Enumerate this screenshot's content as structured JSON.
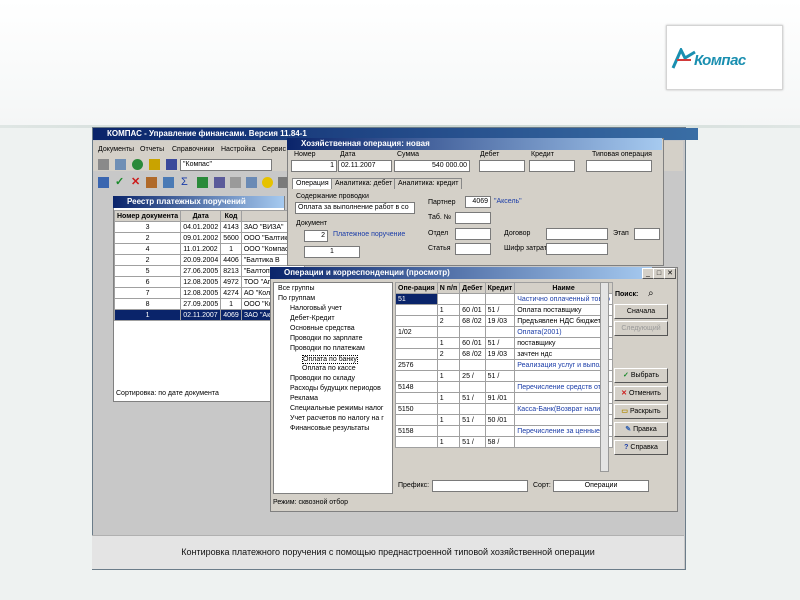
{
  "logo": {
    "text": "Компас"
  },
  "caption": "Контировка платежного поручения с помощью преднастроенной типовой хозяйственной операции",
  "app": {
    "title": "КОМПАС - Управление финансами. Версия 11.84-1",
    "menu": [
      "Документы",
      "Отчеты",
      "Справочники",
      "Настройка",
      "Сервис"
    ],
    "org_field": "\"Компас\""
  },
  "registry": {
    "title": "Реестр платежных поручений",
    "headers": [
      "Номер документа",
      "Дата",
      "Код",
      ""
    ],
    "rows": [
      [
        "3",
        "04.01.2002",
        "4143",
        "ЗАО \"ВИЗА\""
      ],
      [
        "2",
        "09.01.2002",
        "5600",
        "ООО \"Балтика Ро"
      ],
      [
        "4",
        "11.01.2002",
        "1",
        "ООО \"Компас\""
      ],
      [
        "2",
        "20.09.2004",
        "4406",
        "\"Балтика В"
      ],
      [
        "5",
        "27.06.2005",
        "8213",
        "\"Балтоптто"
      ],
      [
        "6",
        "12.08.2005",
        "4972",
        "ТОО \"Апре"
      ],
      [
        "7",
        "12.08.2005",
        "4274",
        "АО \"Колобс"
      ],
      [
        "8",
        "27.09.2005",
        "1",
        "ООО \"Конт"
      ],
      [
        "1",
        "02.11.2007",
        "4069",
        "ЗАО \"Аксел"
      ]
    ],
    "status": "Сортировка: по дате документа"
  },
  "hoz": {
    "title": "Хозяйственная операция: новая",
    "labels": {
      "nomer": "Номер",
      "data": "Дата",
      "summa": "Сумма",
      "debet": "Дебет",
      "kredit": "Кредит",
      "tip": "Типовая операция",
      "soderzhanie": "Содержание проводки",
      "partner": "Партнер",
      "tab": "Таб. №",
      "otdel": "Отдел",
      "dogovor": "Договор",
      "etap": "Этап",
      "statya": "Статья",
      "shifr": "Шифр затрат",
      "dokument": "Документ"
    },
    "values": {
      "nomer": "1",
      "data": "02.11.2007",
      "summa": "540 000.00",
      "soderzhanie": "Оплата за выполнение работ в со",
      "partner_code": "4069",
      "partner_name": "\"Аксель\"",
      "doc_num": "2",
      "doc_type": "Платежное поручение",
      "doc_n2": "1"
    },
    "tabs": [
      "Операция",
      "Аналитика: дебет",
      "Аналитика: кредит"
    ]
  },
  "ops": {
    "title": "Операции и корреспонденции (просмотр)",
    "tree": [
      "Все группы",
      "По группам",
      "Налоговый учет",
      "Дебет-Кредит",
      "Основные средства",
      "Проводки по зарплате",
      "Проводки по платежам",
      "Оплата по банку",
      "Оплата по кассе",
      "Проводки по складу",
      "Расходы будущих периодов",
      "Реклама",
      "Специальные режимы налог",
      "Учет расчетов по налогу на г",
      "Финансовые результаты"
    ],
    "headers": [
      "Опе-рация",
      "N п/п",
      "Дебет",
      "Кредит",
      "Наиме"
    ],
    "rows": [
      [
        "51",
        "",
        "",
        "",
        "Частично оплаченный товар"
      ],
      [
        "",
        "1",
        "60 /01",
        "51 /",
        "Оплата поставщику"
      ],
      [
        "",
        "2",
        "68 /02",
        "19 /03",
        "Предъявлен НДС бюджету"
      ],
      [
        "1/02",
        "",
        "",
        "",
        "Оплата(2001)"
      ],
      [
        "",
        "1",
        "60 /01",
        "51 /",
        "поставщику"
      ],
      [
        "",
        "2",
        "68 /02",
        "19 /03",
        "зачтен ндс"
      ],
      [
        "2576",
        "",
        "",
        "",
        "Реализация услуг и выполн."
      ],
      [
        "",
        "1",
        "25 /",
        "51 /",
        ""
      ],
      [
        "5148",
        "",
        "",
        "",
        "Перечисление средств от п"
      ],
      [
        "",
        "1",
        "51 /",
        "91 /01",
        ""
      ],
      [
        "5150",
        "",
        "",
        "",
        "Касса-Банк(Возврат наличн"
      ],
      [
        "",
        "1",
        "51 /",
        "50 /01",
        ""
      ],
      [
        "5158",
        "",
        "",
        "",
        "Перечисление за ценные бу"
      ],
      [
        "",
        "1",
        "51 /",
        "58 /",
        ""
      ]
    ],
    "search_label": "Поиск:",
    "prefix_label": "Префикс:",
    "sort_label": "Сорт:",
    "sort_value": "Операции",
    "status": "Режим: сквозной отбор",
    "buttons": {
      "first": "Сначала",
      "next": "Следующий",
      "select": "Выбрать",
      "cancel": "Отменить",
      "open": "Раскрыть",
      "edit": "Правка",
      "help": "Справка"
    }
  },
  "colors": {
    "accent": "#0a246a",
    "teal": "#1a8fb0"
  }
}
